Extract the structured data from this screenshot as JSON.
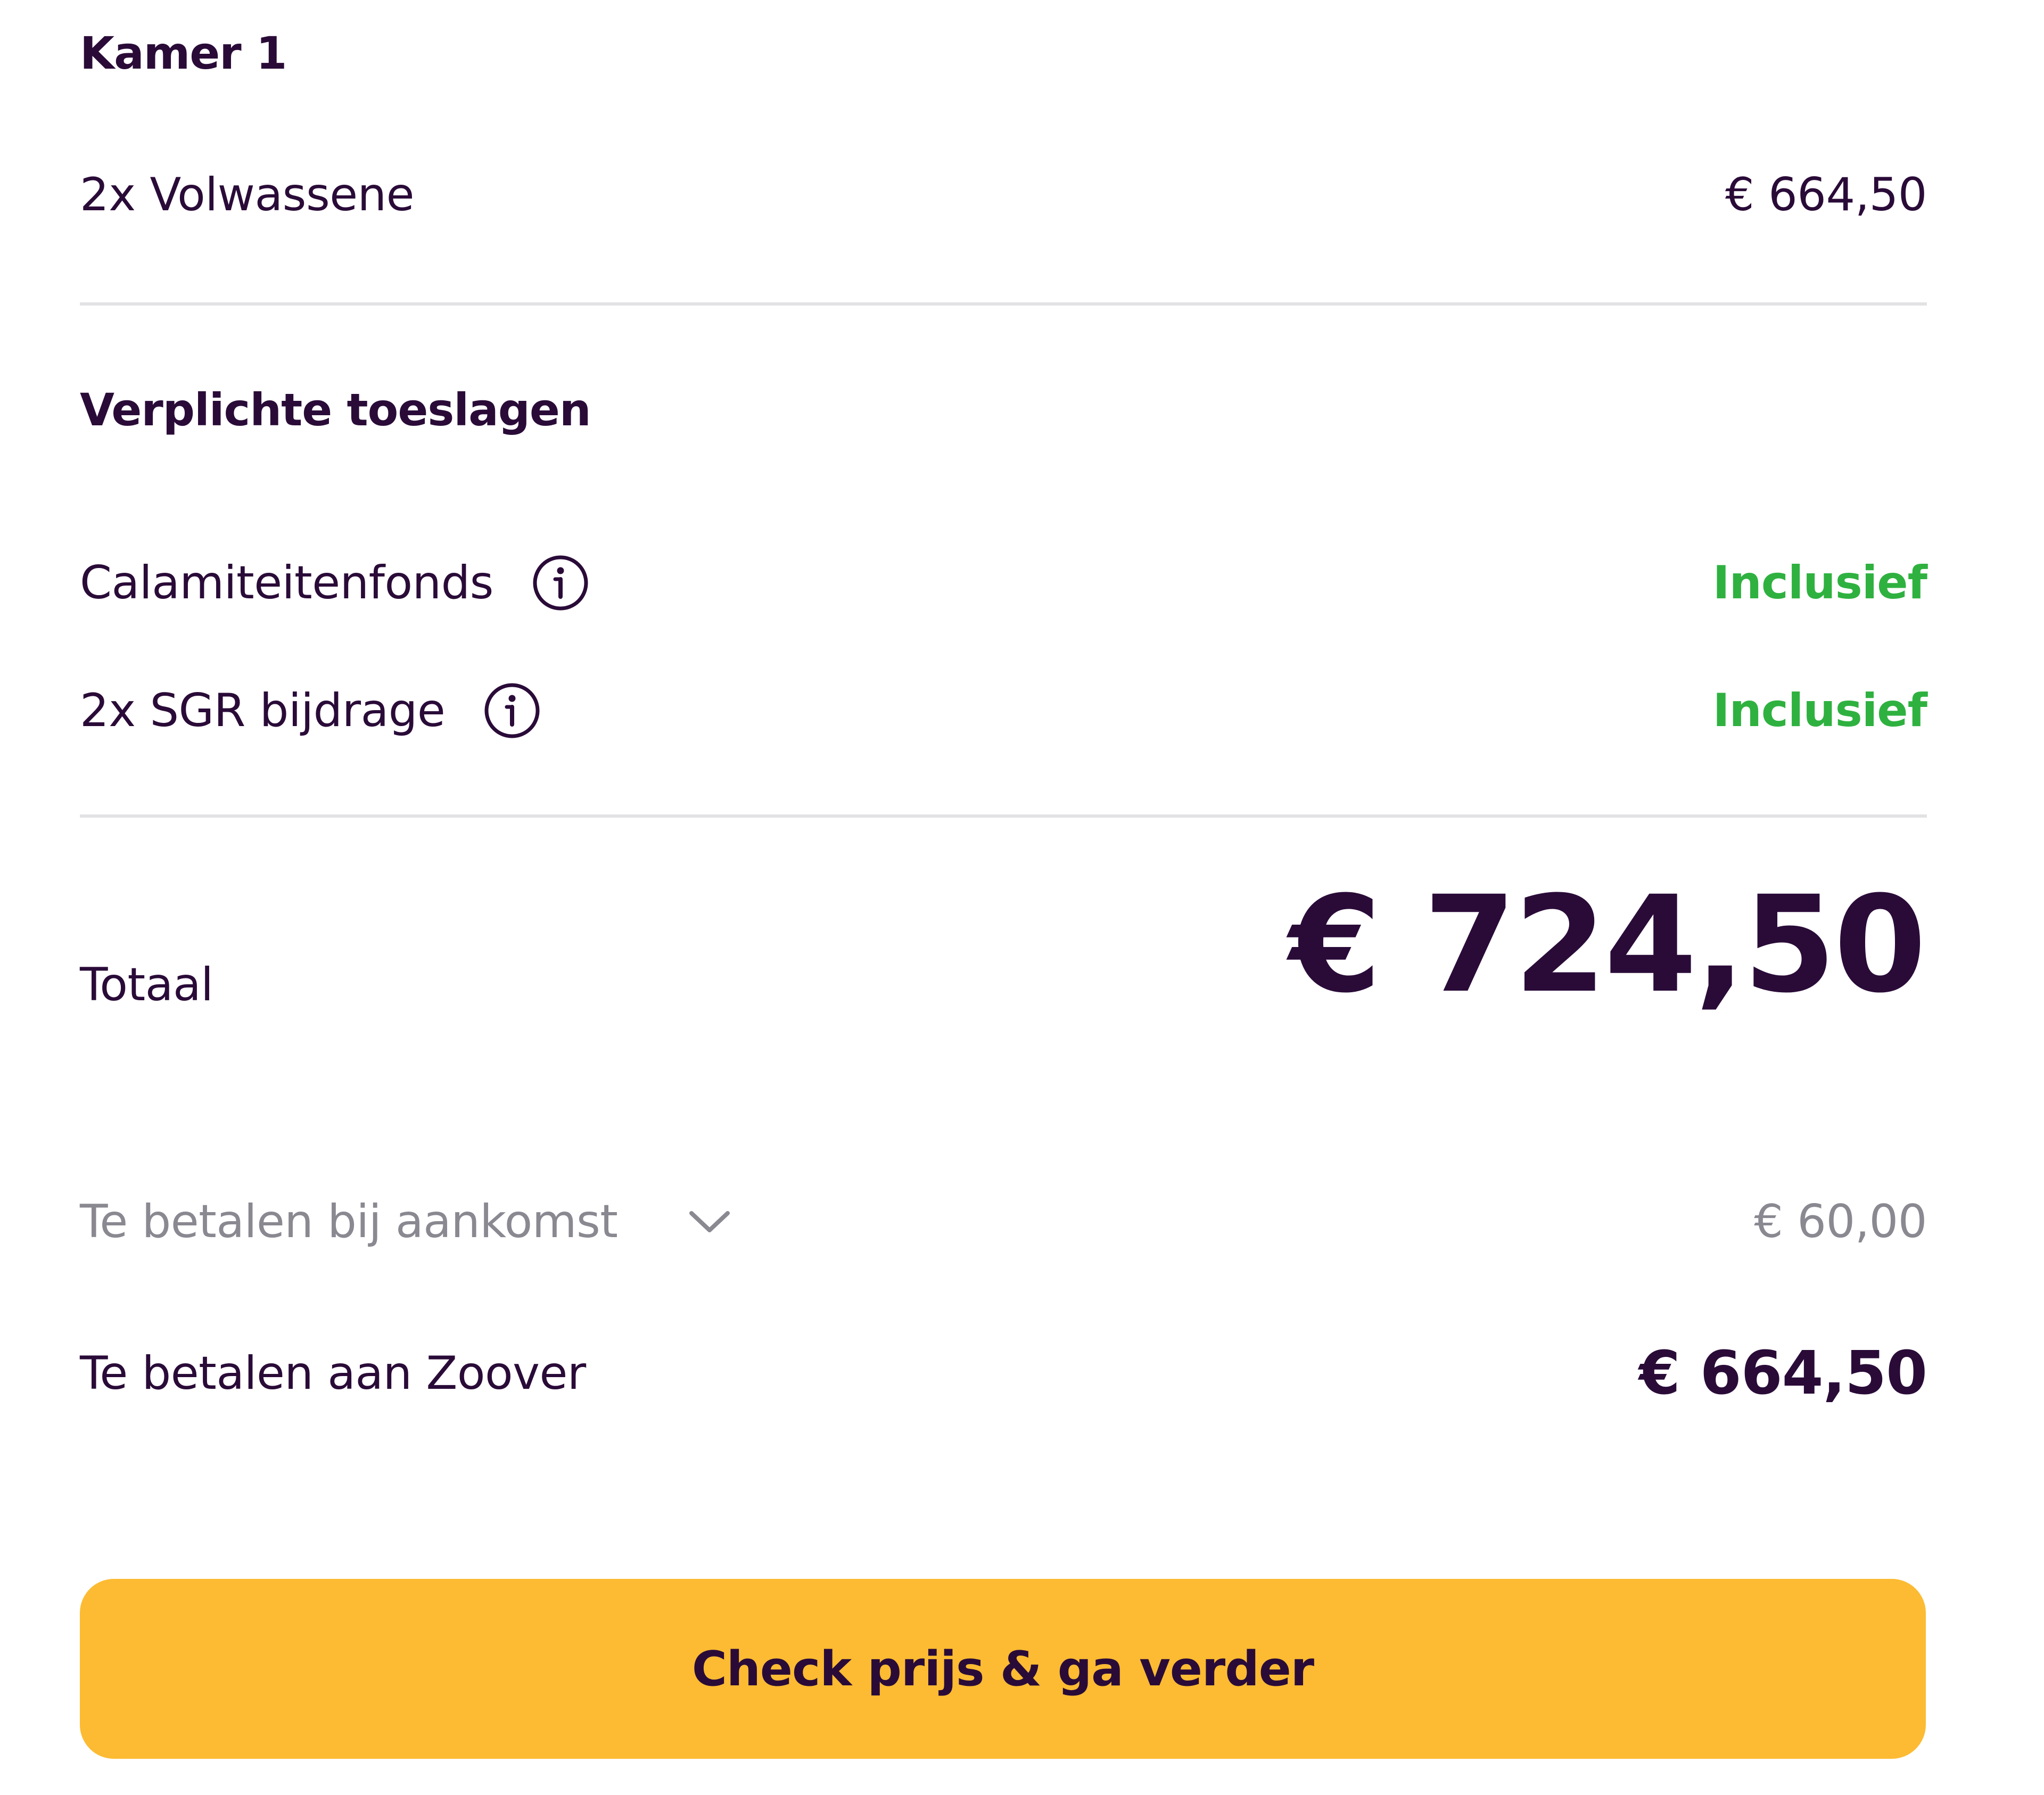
{
  "room": {
    "title": "Kamer 1",
    "adults_label": "2x Volwassene",
    "adults_price": "€ 664,50"
  },
  "surcharges": {
    "title": "Verplichte toeslagen",
    "items": [
      {
        "label": "Calamiteitenfonds",
        "value": "Inclusief",
        "icon": "info-icon"
      },
      {
        "label": "2x SGR bijdrage",
        "value": "Inclusief",
        "icon": "info-icon"
      }
    ]
  },
  "total": {
    "label": "Totaal",
    "amount": "€ 724,50"
  },
  "on_arrival": {
    "label": "Te betalen bij aankomst",
    "amount": "€ 60,00",
    "icon": "chevron-down-icon"
  },
  "to_zoover": {
    "label": "Te betalen aan Zoover",
    "amount": "€ 664,50"
  },
  "cta": {
    "label": "Check prijs & ga verder"
  },
  "colors": {
    "text": "#2a0b38",
    "included": "#2fb140",
    "muted": "#8a8890",
    "button": "#fcbb32",
    "divider": "#e2e2e4"
  }
}
